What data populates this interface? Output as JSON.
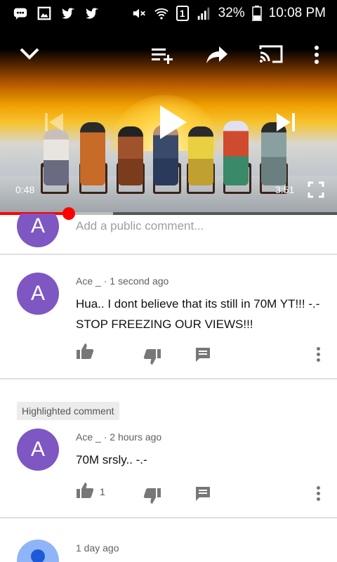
{
  "status_bar": {
    "battery": "32%",
    "time": "10:08 PM",
    "sim_badge": "1",
    "icons_left": [
      "messages-icon",
      "gallery-icon",
      "twitter-icon",
      "twitter-icon"
    ],
    "icons_right": [
      "mute-icon",
      "wifi-icon",
      "sim-icon",
      "signal-icon",
      "battery-icon"
    ]
  },
  "player": {
    "current_time": "0:48",
    "duration": "3:51",
    "progress": 0.205,
    "buffered": 0.335,
    "controls": [
      "collapse-icon",
      "add-to-queue-icon",
      "share-icon",
      "cast-icon",
      "more-icon",
      "previous-icon",
      "play-icon",
      "next-icon",
      "fullscreen-icon"
    ]
  },
  "add_comment": {
    "avatar_letter": "A",
    "placeholder": "Add a public comment..."
  },
  "comments": [
    {
      "avatar_letter": "A",
      "author": "Ace _",
      "time": "1 second ago",
      "text": "Hua.. I dont believe that its still in 70M YT!!! -.- STOP FREEZING OUR VIEWS!!!",
      "likes": ""
    },
    {
      "highlight_label": "Highlighted comment",
      "avatar_letter": "A",
      "author": "Ace _",
      "time": "2 hours ago",
      "text": "70M srsly..  -.-",
      "likes": "1"
    },
    {
      "time": "1 day ago"
    }
  ],
  "colors": {
    "avatar": "#7e57c2",
    "avatar_blue": "#90b4f8",
    "progress_played": "#ff0000"
  }
}
